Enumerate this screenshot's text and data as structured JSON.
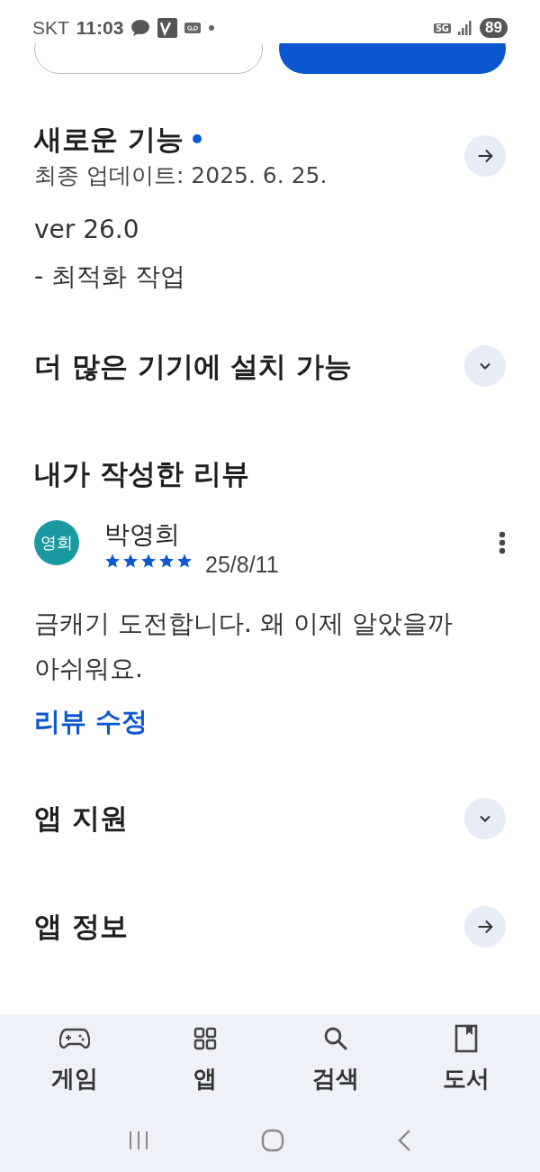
{
  "status_bar": {
    "carrier": "SKT",
    "time": "11:03",
    "battery": "89",
    "network": "5G"
  },
  "whats_new": {
    "title": "새로운 기능",
    "new_dot": true,
    "updated": "최종 업데이트: 2025. 6. 25.",
    "notes": [
      "ver 26.0",
      "- 최적화 작업"
    ]
  },
  "install_more": {
    "title": "더 많은 기기에 설치 가능",
    "expanded": false
  },
  "my_review": {
    "title": "내가 작성한 리뷰",
    "avatar": "영희",
    "author": "박영희",
    "stars": 5,
    "date": "25/8/11",
    "text": "금캐기 도전합니다. 왜 이제 알았을까 아쉬워요.",
    "edit_link": "리뷰 수정"
  },
  "app_support": {
    "title": "앱 지원",
    "expanded": false
  },
  "app_info": {
    "title": "앱 정보"
  },
  "bottom_nav": [
    {
      "kind": "games",
      "label": "게임",
      "selected": false
    },
    {
      "kind": "apps",
      "label": "앱",
      "selected": false
    },
    {
      "kind": "search",
      "label": "검색",
      "selected": false
    },
    {
      "kind": "books",
      "label": "도서",
      "selected": false
    }
  ]
}
